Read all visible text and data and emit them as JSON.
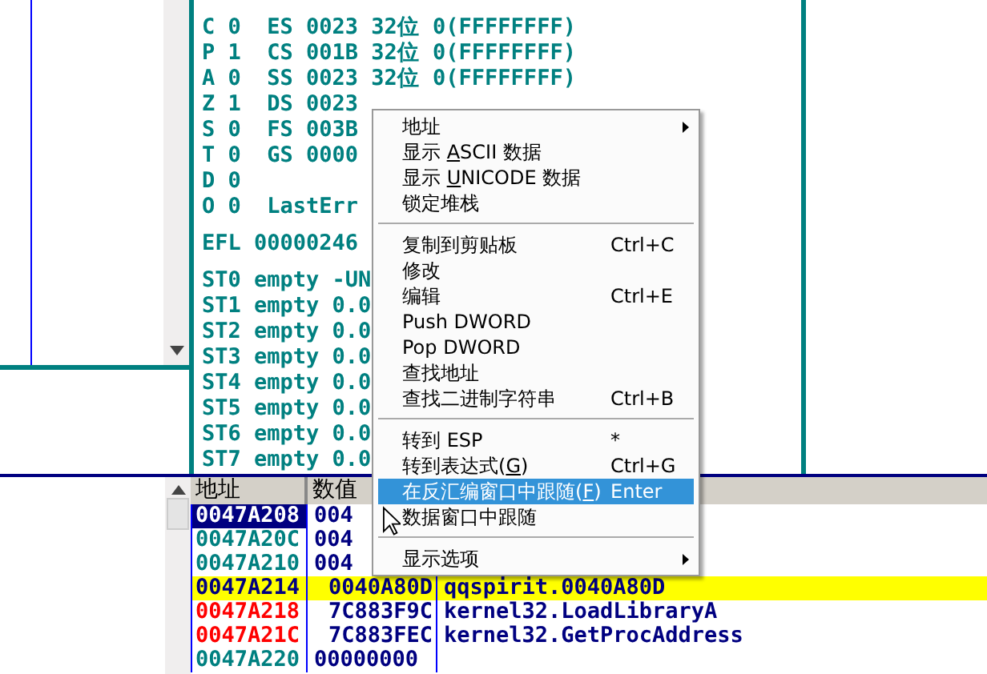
{
  "registers": [
    {
      "text": "C 0  ES 0023 32位 0(FFFFFFFF)"
    },
    {
      "text": "P 1  CS 001B 32位 0(FFFFFFFF)"
    },
    {
      "text": "A 0  SS 0023 32位 0(FFFFFFFF)"
    },
    {
      "text": "Z 1  DS 0023"
    },
    {
      "text": "S 0  FS 003B"
    },
    {
      "text": "T 0  GS 0000"
    },
    {
      "text": "D 0"
    },
    {
      "text": "O 0  LastErr"
    },
    {
      "text": "EFL 00000246",
      "gap": true
    },
    {
      "text": "ST0 empty -UN",
      "gap": true
    },
    {
      "text": "ST1 empty 0.0"
    },
    {
      "text": "ST2 empty 0.0"
    },
    {
      "text": "ST3 empty 0.0"
    },
    {
      "text": "ST4 empty 0.0"
    },
    {
      "text": "ST5 empty 0.0"
    },
    {
      "text": "ST6 empty 0.0"
    },
    {
      "text": "ST7 empty 0.0"
    }
  ],
  "dump": {
    "columns": [
      "地址",
      "数值"
    ],
    "rows": [
      {
        "address": "0047A208",
        "value": "004",
        "selected": true,
        "highlight": false
      },
      {
        "address": "0047A20C",
        "value": "004",
        "selected": false,
        "highlight": false,
        "color": "#008080"
      },
      {
        "address": "0047A210",
        "value": "004",
        "selected": false,
        "highlight": false,
        "color": "#008080"
      },
      {
        "address": "0047A214",
        "value": "0040A80D",
        "comment": "qqspirit.0040A80D",
        "selected": false,
        "highlight": true
      },
      {
        "address": "0047A218",
        "value": "7C883F9C",
        "comment": "kernel32.LoadLibraryA",
        "selected": false,
        "highlight": false,
        "color": "#ff0000"
      },
      {
        "address": "0047A21C",
        "value": "7C883FEC",
        "comment": "kernel32.GetProcAddress",
        "selected": false,
        "highlight": false,
        "color": "#ff0000"
      },
      {
        "address": "0047A220",
        "value": "00000000",
        "selected": false,
        "highlight": false,
        "color": "#008080"
      }
    ]
  },
  "context_menu": [
    {
      "kind": "item",
      "label": "地址",
      "submenu": true,
      "selected": false
    },
    {
      "kind": "item",
      "label": "显示 ",
      "accel": "A",
      "label_rest": "SCII 数据",
      "selected": false
    },
    {
      "kind": "item",
      "label": "显示 ",
      "accel": "U",
      "label_rest": "NICODE 数据",
      "selected": false
    },
    {
      "kind": "item",
      "label": "锁定堆栈",
      "selected": false
    },
    {
      "kind": "separator"
    },
    {
      "kind": "item",
      "label": "复制到剪贴板",
      "shortcut": "Ctrl+C",
      "selected": false
    },
    {
      "kind": "item",
      "label": "修改",
      "selected": false
    },
    {
      "kind": "item",
      "label": "编辑",
      "shortcut": "Ctrl+E",
      "selected": false
    },
    {
      "kind": "item",
      "label": "Push DWORD",
      "selected": false
    },
    {
      "kind": "item",
      "label": "Pop DWORD",
      "selected": false
    },
    {
      "kind": "item",
      "label": "查找地址",
      "selected": false
    },
    {
      "kind": "item",
      "label": "查找二进制字符串",
      "shortcut": "Ctrl+B",
      "selected": false
    },
    {
      "kind": "separator"
    },
    {
      "kind": "item",
      "label": "转到 ESP",
      "shortcut": "*",
      "selected": false
    },
    {
      "kind": "item",
      "label": "转到表达式(",
      "accel": "G",
      "label_rest": ")",
      "shortcut": "Ctrl+G",
      "selected": false
    },
    {
      "kind": "item",
      "label": "在反汇编窗口中跟随(",
      "accel": "F",
      "label_rest": ")",
      "shortcut": "Enter",
      "selected": true
    },
    {
      "kind": "item",
      "label": "数据窗口中跟随",
      "selected": false
    },
    {
      "kind": "separator"
    },
    {
      "kind": "item",
      "label": "显示选项",
      "submenu": true,
      "selected": false
    }
  ]
}
